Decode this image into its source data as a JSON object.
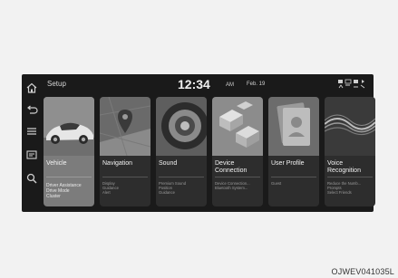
{
  "header": {
    "title": "Setup",
    "time": "12:34",
    "ampm": "AM",
    "date": "Feb. 19"
  },
  "sidebar": {
    "icons": [
      "home-icon",
      "back-icon",
      "menu-icon",
      "media-icon",
      "search-icon"
    ]
  },
  "cards": [
    {
      "label": "Vehicle",
      "lines": [
        "Driver Assistance",
        "Drive Mode",
        "Cluster"
      ],
      "icon": "car-image"
    },
    {
      "label": "Navigation",
      "lines": [
        "Display",
        "Guidance",
        "Alert"
      ],
      "icon": "map-pin-image"
    },
    {
      "label": "Sound",
      "lines": [
        "Premium Sound",
        "Position",
        "Guidance"
      ],
      "icon": "speaker-image"
    },
    {
      "label": "Device Connection",
      "lines": [
        "Device Connection...",
        "Bluetooth System..."
      ],
      "icon": "device-blocks-image"
    },
    {
      "label": "User Profile",
      "lines": [
        "Guest"
      ],
      "icon": "profile-cards-image"
    },
    {
      "label": "Voice Recognition",
      "lines": [
        "Reduce the Numb...",
        "Prompts",
        "Select Friends"
      ],
      "icon": "voice-wave-image"
    }
  ],
  "footer_code": "OJWEV041035L",
  "colors": {
    "screen_bg": "#1a1a1a",
    "active_card": "#7c7c7c",
    "card_bg": "#2d2d2d"
  }
}
